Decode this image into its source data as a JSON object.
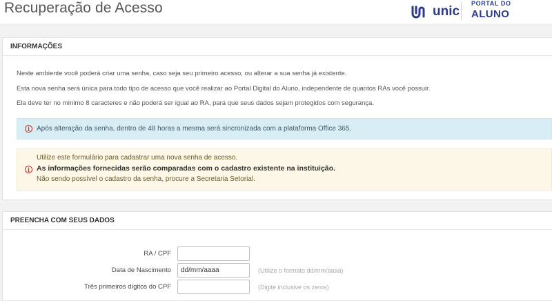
{
  "header": {
    "title": "Recuperação de Acesso",
    "logo": {
      "brand": "unic",
      "portal_line1": "PORTAL DO",
      "portal_line2": "ALUNO",
      "brand_color": "#2d3a8c"
    }
  },
  "info_panel": {
    "heading": "INFORMAÇÕES",
    "lines": [
      "Neste ambiente você poderá criar uma senha, caso seja seu primeiro acesso, ou alterar a sua senha já existente.",
      "Esta nova senha será única para todo tipo de acesso que você realizar ao Portal Digital do Aluno, independente de quantos RAs você possuir.",
      "Ela deve ter no mínimo 8 caracteres e não poderá ser igual ao RA, para que seus dados sejam protegidos com segurança."
    ],
    "alert_info": {
      "icon": "info-icon",
      "text": "Após alteração da senha, dentro de 48 horas a mesma será sincronizada com a plataforma Office 365."
    },
    "alert_warning": {
      "icon": "info-icon",
      "line1": "Utilize este formulário para cadastrar uma nova senha de acesso.",
      "line2": "As informações fornecidas serão comparadas com o cadastro existente na instituição.",
      "line3": "Não sendo possível o cadastro da senha, procure a Secretaria Setorial."
    }
  },
  "form_panel": {
    "heading": "PREENCHA COM SEUS DADOS",
    "fields": [
      {
        "label": "RA / CPF",
        "value": "",
        "placeholder": "",
        "hint": ""
      },
      {
        "label": "Data de Nascimento",
        "value": "dd/mm/aaaa",
        "placeholder": "dd/mm/aaaa",
        "hint": "(Utilize o formato dd/mm/aaaa)"
      },
      {
        "label": "Três primeiros dígitos do CPF",
        "value": "",
        "placeholder": "",
        "hint": "(Digite inclusive os zeros)"
      }
    ]
  }
}
